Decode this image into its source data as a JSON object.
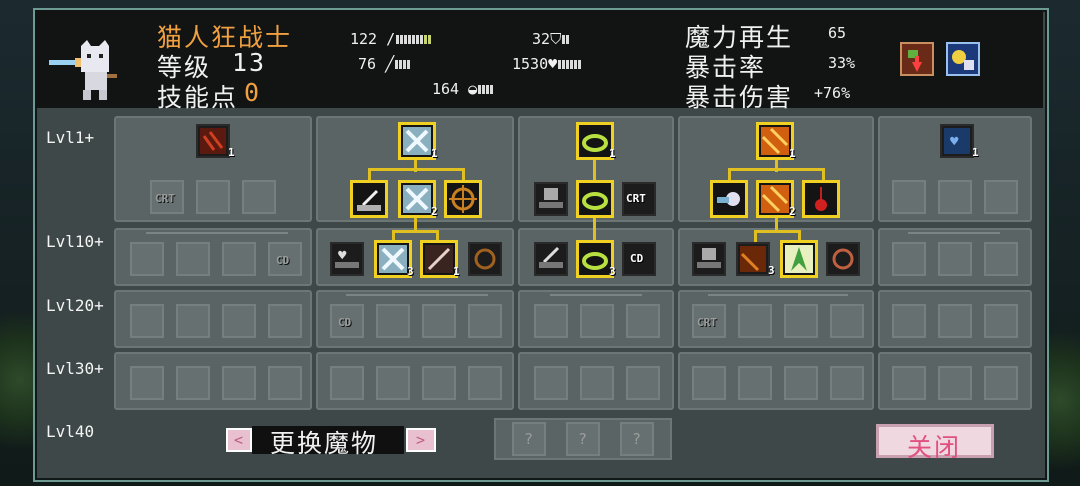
{
  "header": {
    "name": "猫人狂战士",
    "level_label": "等级",
    "level_value": "13",
    "skill_label": "技能点",
    "skill_value": "0",
    "stats": [
      {
        "value": "122",
        "icon": "sword-icon"
      },
      {
        "value": "76",
        "icon": "wand-icon"
      },
      {
        "value": "164",
        "icon": "speed-icon"
      },
      {
        "value": "32",
        "icon": "shield-icon"
      },
      {
        "value": "1530",
        "icon": "heart-icon"
      }
    ],
    "right_stats": [
      {
        "label": "魔力再生",
        "value": "65"
      },
      {
        "label": "暴击率",
        "value": "33%"
      },
      {
        "label": "暴击伤害",
        "value": "+76%"
      }
    ]
  },
  "levels": [
    "Lvl1+",
    "Lvl10+",
    "Lvl20+",
    "Lvl30+",
    "Lvl40"
  ],
  "counts": {
    "c1": "1",
    "c2": "1",
    "c2b": "2",
    "c2c": "3",
    "c2d": "1",
    "c3": "1",
    "c3b": "3",
    "c4": "1",
    "c4b": "2",
    "c4c": "3",
    "c5": "1"
  },
  "ghost_text": {
    "crt": "CRT",
    "cd": "CD"
  },
  "footer": {
    "change_monster": "更换魔物",
    "prev": "<",
    "next": ">",
    "unknown": "?",
    "close": "关闭"
  },
  "colors": {
    "accent": "#f0d020",
    "name": "#f0a040",
    "panel": "#3e4848"
  }
}
